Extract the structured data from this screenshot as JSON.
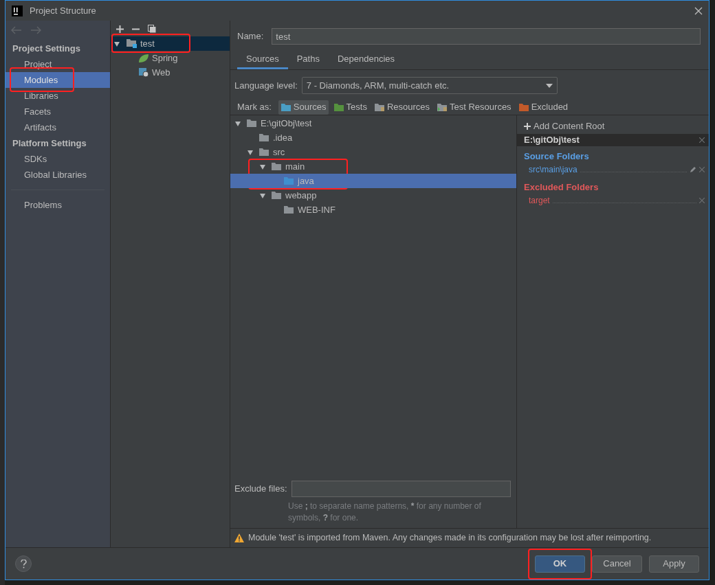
{
  "window": {
    "title": "Project Structure"
  },
  "sidebar": {
    "sections": [
      {
        "heading": "Project Settings",
        "items": [
          {
            "label": "Project",
            "selected": false,
            "annotated": false
          },
          {
            "label": "Modules",
            "selected": true,
            "annotated": true
          },
          {
            "label": "Libraries",
            "selected": false,
            "annotated": false
          },
          {
            "label": "Facets",
            "selected": false,
            "annotated": false
          },
          {
            "label": "Artifacts",
            "selected": false,
            "annotated": false
          }
        ]
      },
      {
        "heading": "Platform Settings",
        "items": [
          {
            "label": "SDKs",
            "selected": false,
            "annotated": false
          },
          {
            "label": "Global Libraries",
            "selected": false,
            "annotated": false
          }
        ]
      }
    ],
    "extra_items": [
      {
        "label": "Problems",
        "selected": false,
        "annotated": false
      }
    ]
  },
  "module_tree": [
    {
      "label": "test",
      "kind": "module",
      "selected": true,
      "annotated": true,
      "expanded": true,
      "children": [
        {
          "label": "Spring",
          "kind": "spring",
          "selected": false,
          "annotated": false
        },
        {
          "label": "Web",
          "kind": "web",
          "selected": false,
          "annotated": false
        }
      ]
    }
  ],
  "name_field": {
    "label": "Name:",
    "value": "test"
  },
  "tabs": [
    {
      "label": "Sources",
      "selected": true
    },
    {
      "label": "Paths",
      "selected": false
    },
    {
      "label": "Dependencies",
      "selected": false
    }
  ],
  "language_level": {
    "label": "Language level:",
    "value": "7 - Diamonds, ARM, multi-catch etc."
  },
  "mark_as": {
    "label": "Mark as:",
    "buttons": [
      {
        "label": "Sources",
        "kind": "sources",
        "selected": true
      },
      {
        "label": "Tests",
        "kind": "tests",
        "selected": false
      },
      {
        "label": "Resources",
        "kind": "resources",
        "selected": false
      },
      {
        "label": "Test Resources",
        "kind": "test_resources",
        "selected": false
      },
      {
        "label": "Excluded",
        "kind": "excluded",
        "selected": false
      }
    ]
  },
  "source_tree": [
    {
      "label": "E:\\gitObj\\test",
      "kind": "folder",
      "expanded": true,
      "selected": false,
      "annotated": false,
      "children": [
        {
          "label": ".idea",
          "kind": "folder",
          "selected": false,
          "annotated": false
        },
        {
          "label": "src",
          "kind": "folder",
          "expanded": true,
          "selected": false,
          "annotated": false,
          "children": [
            {
              "label": "main",
              "kind": "folder",
              "expanded": true,
              "selected": false,
              "annotated": true,
              "children": [
                {
                  "label": "java",
                  "kind": "source",
                  "selected": true,
                  "annotated": false
                }
              ]
            },
            {
              "label": "webapp",
              "kind": "folder",
              "expanded": true,
              "selected": false,
              "annotated": false,
              "children": [
                {
                  "label": "WEB-INF",
                  "kind": "folder",
                  "selected": false,
                  "annotated": false
                }
              ]
            }
          ]
        }
      ]
    }
  ],
  "content_root": {
    "add_label": "Add Content Root",
    "path": "E:\\gitObj\\test",
    "groups": [
      {
        "title": "Source Folders",
        "kind": "source",
        "folders": [
          "src\\main\\java"
        ]
      },
      {
        "title": "Excluded Folders",
        "kind": "excluded",
        "folders": [
          "target"
        ]
      }
    ]
  },
  "exclude_files": {
    "label": "Exclude files:",
    "hint_parts": [
      {
        "text": "Use ",
        "bold": false
      },
      {
        "text": ";",
        "bold": true
      },
      {
        "text": " to separate name patterns, ",
        "bold": false
      },
      {
        "text": "*",
        "bold": true
      },
      {
        "text": " for any number of symbols, ",
        "bold": false
      },
      {
        "text": "?",
        "bold": true
      },
      {
        "text": " for one.",
        "bold": false
      }
    ]
  },
  "warning": "Module 'test' is imported from Maven. Any changes made in its configuration may be lost after reimporting.",
  "buttons": [
    {
      "label": "OK",
      "kind": "primary",
      "annotated": true
    },
    {
      "label": "Cancel",
      "kind": "normal",
      "annotated": false
    },
    {
      "label": "Apply",
      "kind": "normal",
      "annotated": false
    }
  ]
}
